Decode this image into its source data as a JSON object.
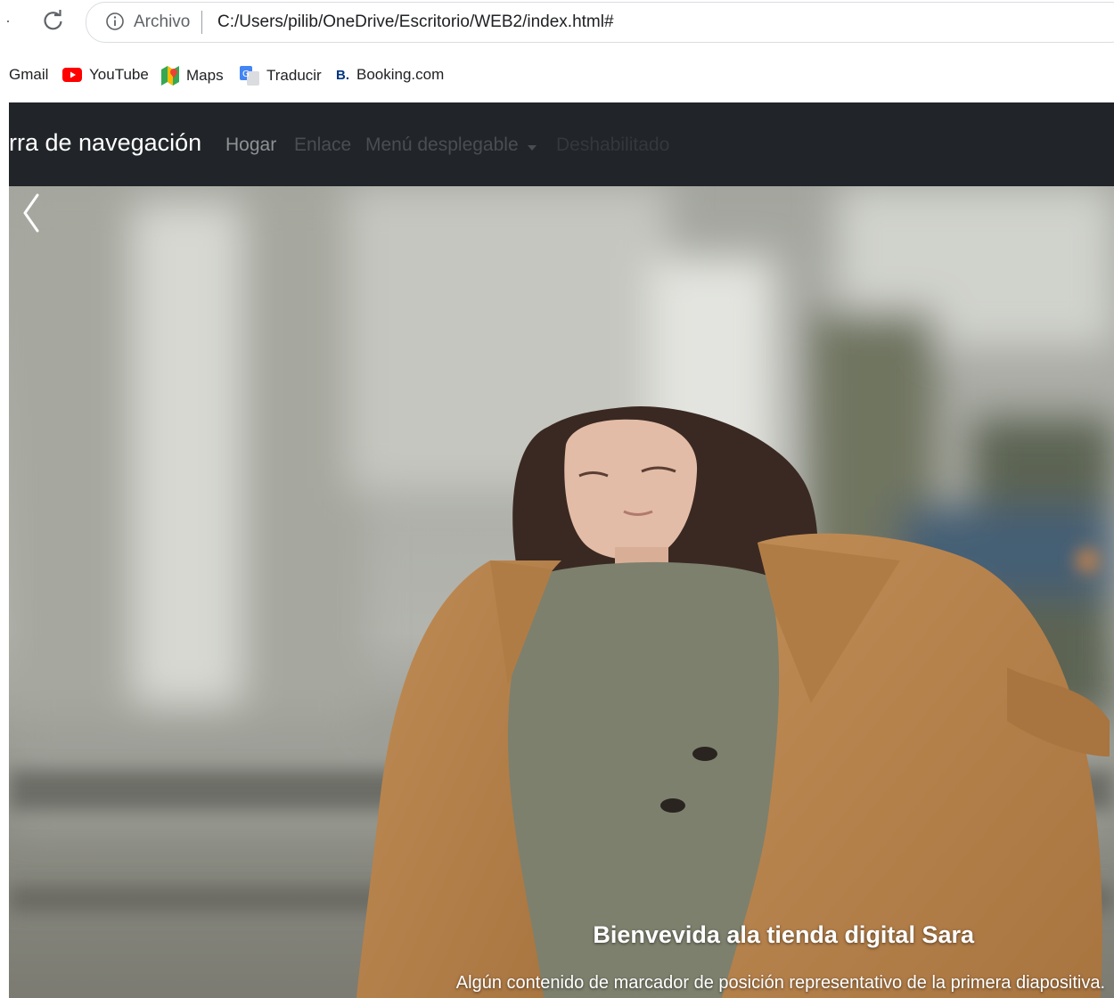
{
  "browser": {
    "security_label": "Archivo",
    "url": "C:/Users/pilib/OneDrive/Escritorio/WEB2/index.html#",
    "bookmarks": [
      {
        "label": "Gmail",
        "icon": "gmail-icon"
      },
      {
        "label": "YouTube",
        "icon": "youtube-icon"
      },
      {
        "label": "Maps",
        "icon": "maps-icon"
      },
      {
        "label": "Traducir",
        "icon": "translate-icon"
      },
      {
        "label": "Booking.com",
        "icon": "booking-icon"
      }
    ]
  },
  "navbar": {
    "brand": "rra de navegación",
    "links": {
      "home": "Hogar",
      "link": "Enlace",
      "dropdown": "Menú desplegable",
      "disabled": "Deshabilitado"
    },
    "background_color": "#212529"
  },
  "carousel": {
    "caption_title": "Bienvevida ala tienda digital Sara",
    "caption_text": "Algún contenido de marcador de posición representativo de la primera diapositiva.",
    "prev_icon": "chevron-left-icon"
  }
}
